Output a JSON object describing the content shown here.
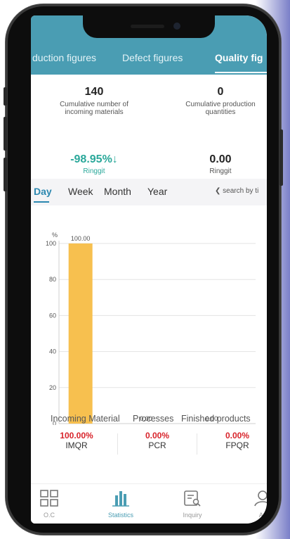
{
  "tabs": {
    "items": [
      "duction figures",
      "Defect figures",
      "Quality fig"
    ],
    "active_index": 2
  },
  "summary": {
    "incoming_count": "140",
    "incoming_label_line1": "Cumulative number of",
    "incoming_label_line2": "incoming materials",
    "production_count": "0",
    "production_label_line1": "Cumulative production",
    "production_label_line2": "quantities",
    "change_pct": "-98.95%",
    "change_arrow": "↓",
    "change_unit": "Ringgit",
    "amount": "0.00",
    "amount_unit": "Ringgit"
  },
  "period": {
    "items": [
      "Day",
      "Week",
      "Month",
      "Year"
    ],
    "active": "Day",
    "search_label": "search by ti"
  },
  "chart_data": {
    "type": "bar",
    "categories": [
      "Incoming Material",
      "Processes",
      "Finished products"
    ],
    "values": [
      100.0,
      0.0,
      0.0
    ],
    "data_labels": [
      "100.00",
      "0.00",
      "0.00"
    ],
    "ylabel": "%",
    "ylim": [
      0,
      100
    ],
    "yticks": [
      0,
      20,
      40,
      60,
      80,
      100
    ],
    "grid": true,
    "bar_color": "#f7c04f"
  },
  "ratios": [
    {
      "value": "100.00%",
      "label": "IMQR"
    },
    {
      "value": "0.00%",
      "label": "PCR"
    },
    {
      "value": "0.00%",
      "label": "FPQR"
    }
  ],
  "colors": {
    "header": "#4a9db3",
    "positive_change": "#2aa89a",
    "ratio_value": "#d8232a",
    "accent": "#2c88b0"
  },
  "bottom_nav": [
    {
      "label": "O.C",
      "icon": "grid-icon"
    },
    {
      "label": "Statistics",
      "icon": "bar-chart-icon"
    },
    {
      "label": "Inquiry",
      "icon": "document-search-icon"
    },
    {
      "label": "Ac",
      "icon": "user-icon"
    }
  ],
  "bottom_nav_active": "Statistics"
}
